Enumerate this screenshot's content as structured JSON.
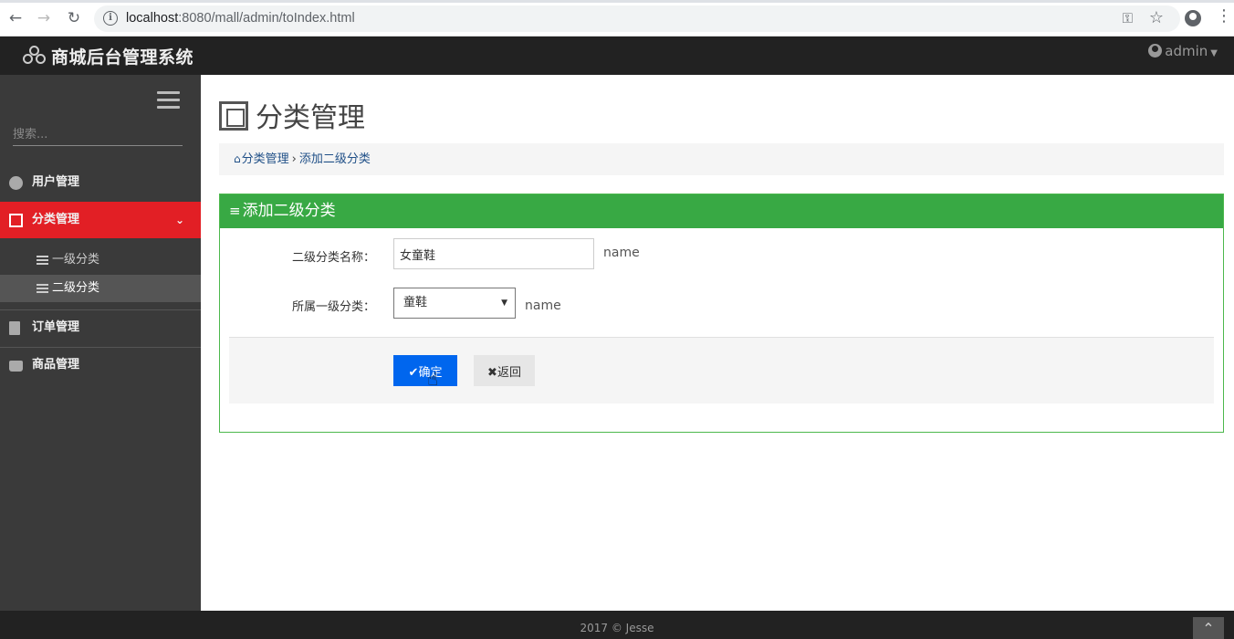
{
  "browser": {
    "url_host": "localhost",
    "url_rest": ":8080/mall/admin/toIndex.html"
  },
  "header": {
    "brand": "商城后台管理系统",
    "user": "admin"
  },
  "sidebar": {
    "search_placeholder": "搜索...",
    "items": [
      {
        "label": "用户管理"
      },
      {
        "label": "分类管理"
      },
      {
        "label": "订单管理"
      },
      {
        "label": "商品管理"
      }
    ],
    "sub_items": [
      {
        "label": "一级分类"
      },
      {
        "label": "二级分类"
      }
    ]
  },
  "main": {
    "page_title": "分类管理",
    "breadcrumb": {
      "home": "分类管理",
      "separator": "›",
      "current": "添加二级分类"
    },
    "panel": {
      "title": "添加二级分类",
      "name_label": "二级分类名称：",
      "name_value": "女童鞋",
      "name_hint": "name",
      "parent_label": "所属一级分类：",
      "parent_selected": "童鞋",
      "parent_hint": "name",
      "ok_label": "确定",
      "back_label": "返回"
    }
  },
  "footer": {
    "text": "2017 © Jesse"
  },
  "colors": {
    "active_menu": "#e21f25",
    "panel_green": "#38a944",
    "primary_blue": "#0066ee"
  }
}
